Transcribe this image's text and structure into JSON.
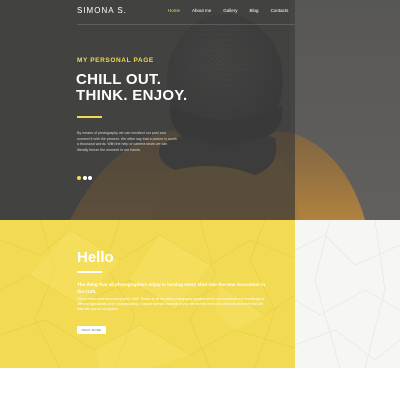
{
  "header": {
    "logo": "SIMONA S.",
    "nav": [
      {
        "label": "Home",
        "active": true
      },
      {
        "label": "About me",
        "active": false
      },
      {
        "label": "Gallery",
        "active": false
      },
      {
        "label": "Blog",
        "active": false
      },
      {
        "label": "Contacts",
        "active": false
      }
    ]
  },
  "hero": {
    "kicker": "MY PERSONAL PAGE",
    "title_line1": "CHILL OUT.",
    "title_line2": "THINK. ENJOY.",
    "body": "By means of photography we can recollect our past and connect it with the present. We often say that a picture is worth a thousand words. With the help of camera shots we can literally freeze the moment in our hands.",
    "slider_dots": 3,
    "active_dot": 1
  },
  "intro": {
    "title": "Hello",
    "lead": "The thing that all photographers enjoy is turning every shot into the new innovation in the craft.",
    "body": "This is what I have been doing since 1998. Thanks to all the latest photography gadgets and to my experience and knowledge of different approaches in the photographing, I capture special moments of your life and turn them into precious memories that will stay with you for a long time.",
    "button": "READ MORE"
  },
  "colors": {
    "accent_yellow": "#f2db53",
    "dark_overlay": "#3a3a3a",
    "white": "#ffffff"
  }
}
